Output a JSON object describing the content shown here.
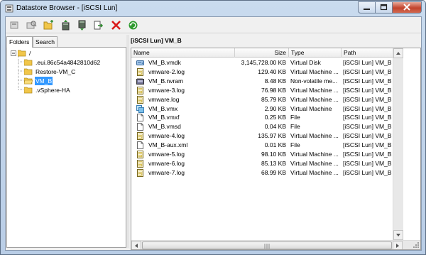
{
  "window": {
    "title": "Datastore Browser - [iSCSI Lun]"
  },
  "toolbar": {
    "buttons": [
      {
        "name": "back-button",
        "icon": "back-icon"
      },
      {
        "name": "browse-button",
        "icon": "search-folder-icon"
      },
      {
        "name": "new-folder-button",
        "icon": "new-folder-icon"
      },
      {
        "name": "upload-button",
        "icon": "upload-icon"
      },
      {
        "name": "download-button",
        "icon": "download-icon"
      },
      {
        "name": "move-button",
        "icon": "move-icon"
      },
      {
        "name": "delete-button",
        "icon": "delete-icon"
      },
      {
        "name": "refresh-button",
        "icon": "refresh-icon"
      }
    ]
  },
  "left": {
    "tabs": [
      "Folders",
      "Search"
    ],
    "tree": [
      {
        "label": "/",
        "level": 0
      },
      {
        "label": ".eui.86c54a4842810d62",
        "level": 1
      },
      {
        "label": "Restore-VM_C",
        "level": 1
      },
      {
        "label": "VM_B",
        "level": 1,
        "selected": true
      },
      {
        "label": ".vSphere-HA",
        "level": 1
      }
    ]
  },
  "right": {
    "path": "[iSCSI Lun] VM_B",
    "columns": [
      "Name",
      "Size",
      "Type",
      "Path"
    ],
    "rows": [
      {
        "name": "VM_B.vmdk",
        "size": "3,145,728.00 KB",
        "type": "Virtual Disk",
        "path": "[iSCSI Lun] VM_B",
        "icon": "disk-icon"
      },
      {
        "name": "vmware-2.log",
        "size": "129.40 KB",
        "type": "Virtual Machine ...",
        "path": "[iSCSI Lun] VM_B",
        "icon": "log-icon"
      },
      {
        "name": "VM_B.nvram",
        "size": "8.48 KB",
        "type": "Non-volatile me...",
        "path": "[iSCSI Lun] VM_B",
        "icon": "nvram-icon"
      },
      {
        "name": "vmware-3.log",
        "size": "76.98 KB",
        "type": "Virtual Machine ...",
        "path": "[iSCSI Lun] VM_B",
        "icon": "log-icon"
      },
      {
        "name": "vmware.log",
        "size": "85.79 KB",
        "type": "Virtual Machine ...",
        "path": "[iSCSI Lun] VM_B",
        "icon": "log-icon"
      },
      {
        "name": "VM_B.vmx",
        "size": "2.90 KB",
        "type": "Virtual Machine",
        "path": "[iSCSI Lun] VM_B",
        "icon": "vm-icon"
      },
      {
        "name": "VM_B.vmxf",
        "size": "0.25 KB",
        "type": "File",
        "path": "[iSCSI Lun] VM_B",
        "icon": "file-icon"
      },
      {
        "name": "VM_B.vmsd",
        "size": "0.04 KB",
        "type": "File",
        "path": "[iSCSI Lun] VM_B",
        "icon": "file-icon"
      },
      {
        "name": "vmware-4.log",
        "size": "135.97 KB",
        "type": "Virtual Machine ...",
        "path": "[iSCSI Lun] VM_B",
        "icon": "log-icon"
      },
      {
        "name": "VM_B-aux.xml",
        "size": "0.01 KB",
        "type": "File",
        "path": "[iSCSI Lun] VM_B",
        "icon": "file-icon"
      },
      {
        "name": "vmware-5.log",
        "size": "98.10 KB",
        "type": "Virtual Machine ...",
        "path": "[iSCSI Lun] VM_B",
        "icon": "log-icon"
      },
      {
        "name": "vmware-6.log",
        "size": "85.13 KB",
        "type": "Virtual Machine ...",
        "path": "[iSCSI Lun] VM_B",
        "icon": "log-icon"
      },
      {
        "name": "vmware-7.log",
        "size": "68.99 KB",
        "type": "Virtual Machine ...",
        "path": "[iSCSI Lun] VM_B",
        "icon": "log-icon"
      }
    ]
  },
  "colors": {
    "selection": "#3399ff",
    "folder": "#f1c64a",
    "delete": "#d91a1a",
    "refresh": "#2e9a2e"
  }
}
